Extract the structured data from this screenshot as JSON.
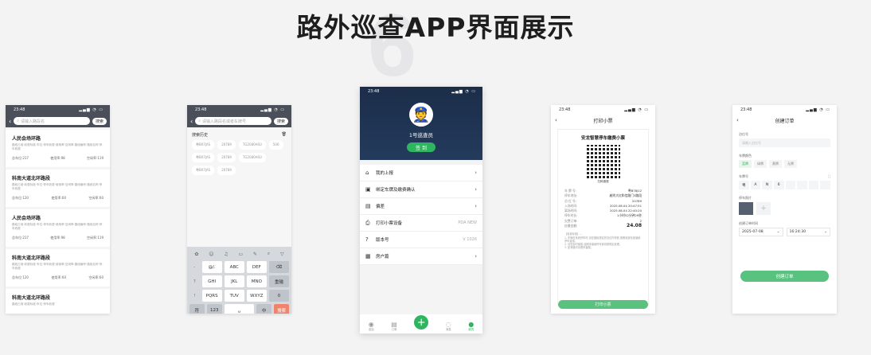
{
  "page_title": "路外巡查APP界面展示",
  "bg_number": "6",
  "p1": {
    "time": "23:48",
    "search_placeholder": "请输入路段名",
    "search_btn": "搜索",
    "cards": [
      {
        "name": "人民会场环路",
        "desc": "路段占用...",
        "total": "总车位:217",
        "used": "使用率:98",
        "idle": "空闲率:119"
      },
      {
        "name": "科南大道北环路段",
        "desc": "路段占用...",
        "total": "总车位:120",
        "used": "使用率:60",
        "idle": "空闲率:60"
      },
      {
        "name": "人民会场环路",
        "desc": "路段占用...",
        "total": "总车位:217",
        "used": "使用率:98",
        "idle": "空闲率:119"
      },
      {
        "name": "科南大道北环路段",
        "desc": "路段占用...",
        "total": "总车位:120",
        "used": "使用率:60",
        "idle": "空闲率:60"
      },
      {
        "name": "科南大道北环路段",
        "desc": "",
        "total": "",
        "used": "",
        "idle": ""
      }
    ]
  },
  "p2": {
    "time": "23:48",
    "search_placeholder": "请输入路段名或者车牌号",
    "search_btn": "搜索",
    "history_label": "搜索历史",
    "chips": [
      "粤B07JAS",
      "20789",
      "TG2080A6U",
      "506",
      "粤B07JAS",
      "20789",
      "TG2080A6U",
      "粤B07JAS",
      "20789"
    ],
    "keys_row1": [
      "@/.",
      "ABC",
      "DEF"
    ],
    "keys_row2": [
      "GHI",
      "JKL",
      "MNO"
    ],
    "keys_row3": [
      "PQRS",
      "TUV",
      "WXYZ"
    ],
    "side_left": [
      "-",
      "?",
      "!"
    ],
    "side_right": [
      "⌫",
      "重输",
      "0"
    ],
    "bottom": [
      "符",
      "123",
      "␣",
      "中",
      "搜索"
    ]
  },
  "p3": {
    "time": "23:48",
    "inspector": "1号巡查员",
    "signout": "签 到",
    "menu": [
      {
        "icon": "⌂",
        "label": "我的上报",
        "value": ""
      },
      {
        "icon": "▣",
        "label": "绑定车牌及缴费确认",
        "value": ""
      },
      {
        "icon": "▤",
        "label": "偏差",
        "value": ""
      },
      {
        "icon": "⎙",
        "label": "打印小票设备",
        "value": "PDA NEW"
      },
      {
        "icon": "?",
        "label": "版本号",
        "value": "V 1026"
      },
      {
        "icon": "▦",
        "label": "房户篇",
        "value": ""
      }
    ],
    "tabs": [
      "巡检",
      "订单",
      "",
      "消息",
      "我的"
    ]
  },
  "p4": {
    "time": "23:48",
    "title": "打印小票",
    "receipt_title": "安龙智慧停车缴费小票",
    "qr_caption": "扫码缴费",
    "rows": [
      {
        "k": "车 牌 号:",
        "v": "粤B78J12"
      },
      {
        "k": "停车地址:",
        "v": "越秀大红和信路门3路段"
      },
      {
        "k": "泊 位 号:",
        "v": "20789"
      },
      {
        "k": "入场时间:",
        "v": "2025.08.04 20:47:51"
      },
      {
        "k": "离场时间:",
        "v": "2025.08.04 22:40:20"
      },
      {
        "k": "停车时长:",
        "v": "1小时52分钟29秒"
      },
      {
        "k": "欠费订单:",
        "v": "2"
      },
      {
        "k": "应缴金额:",
        "v": "24.08"
      }
    ],
    "notes": "【收费标准】...",
    "print_btn": "打印小票"
  },
  "p5": {
    "time": "23:48",
    "title": "创建订单",
    "f_plot": "泊位号",
    "plot_placeholder": "请输入泊位号",
    "f_color": "车牌颜色",
    "colors": [
      "蓝牌",
      "绿牌",
      "黄牌",
      "无牌"
    ],
    "f_plate": "车牌号",
    "plate_chars": [
      "粤",
      "A",
      "N",
      "6",
      "",
      "",
      "",
      ""
    ],
    "f_photo": "停车照片",
    "f_time": "创建订单时间",
    "date": "2025-07-08",
    "clock": "16:24:30",
    "create_btn": "创建订单"
  }
}
